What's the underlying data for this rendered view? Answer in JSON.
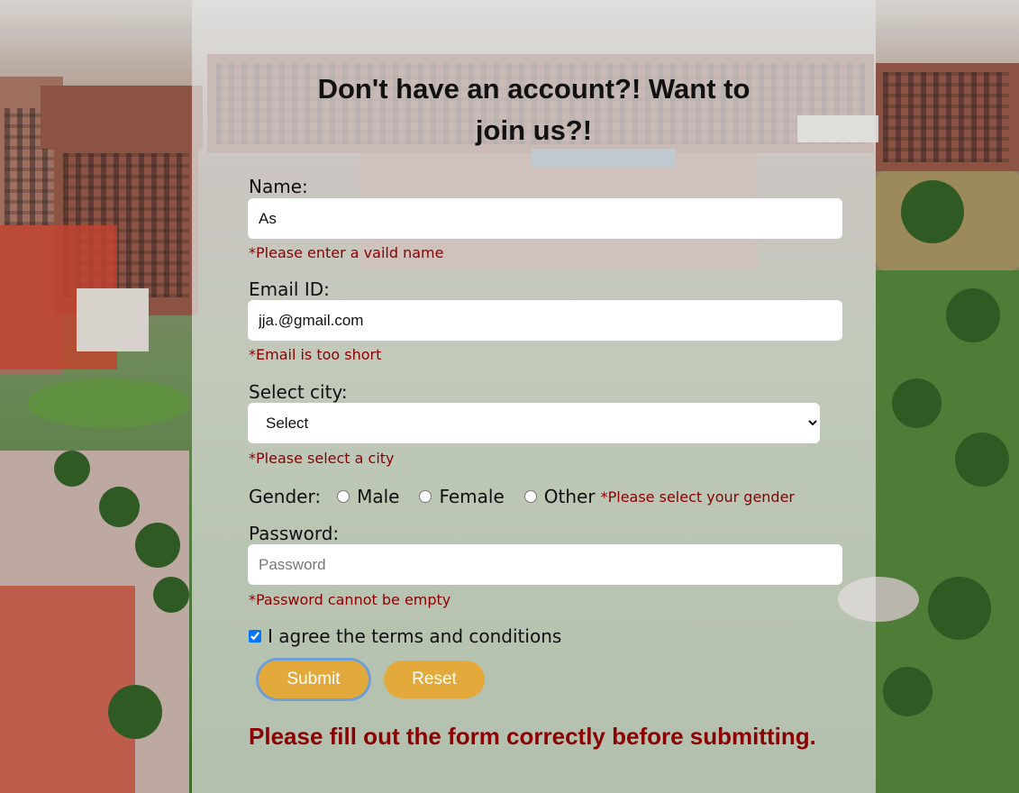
{
  "form": {
    "title_line1": "Don't have an account?! Want to",
    "title_line2": "join us?!",
    "name_label": "Name:",
    "name_value": "As",
    "name_error": "*Please enter a vaild name",
    "email_label": "Email ID:",
    "email_value": "jja.@gmail.com",
    "email_error": "*Email is too short",
    "city_label": "Select city:",
    "city_selected": "Select",
    "city_error": "*Please select a city",
    "gender_label": "Gender:",
    "gender_options": [
      "Male",
      "Female",
      "Other"
    ],
    "gender_error": "*Please select your gender",
    "password_label": "Password:",
    "password_placeholder": "Password",
    "password_error": "*Password cannot be empty",
    "agree_label": "I agree the terms and conditions",
    "agree_checked": true,
    "submit_label": "Submit",
    "reset_label": "Reset",
    "form_error": "Please fill out the form correctly before submitting."
  },
  "colors": {
    "accent_button": "#e3a93a",
    "error_text": "#8b0000",
    "panel_overlay": "#e2e2e0"
  }
}
